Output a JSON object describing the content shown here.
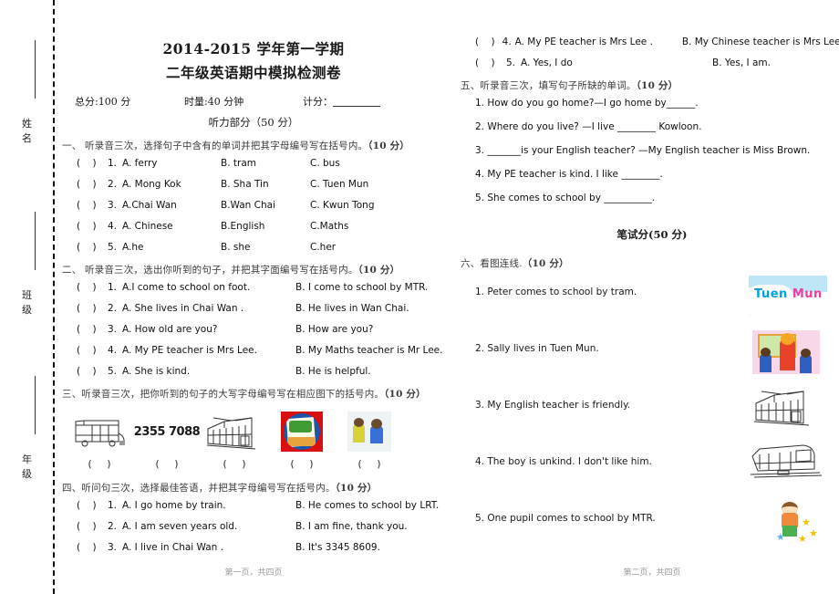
{
  "sidebar": {
    "fields": [
      {
        "label": "姓 名",
        "name": "name-field"
      },
      {
        "label": "班 级",
        "name": "class-field"
      },
      {
        "label": "年 级",
        "name": "grade-field"
      }
    ]
  },
  "header": {
    "title_line1": "2014-2015 学年第一学期",
    "title_line2": "二年级英语期中模拟检测卷",
    "total_score_label": "总分:100 分",
    "time_label": "时量:40 分钟",
    "mark_label": "计分：",
    "listening_part_title": "听力部分（50 分）",
    "written_part_title": "笔试分(50 分)"
  },
  "sections": {
    "s1": {
      "heading": "一、 听录音三次，选择句子中含有的单词并把其字母编号写在括号内。",
      "points": "（10 分）",
      "items": [
        {
          "num": "1.",
          "a": "A. ferry",
          "b": "B. tram",
          "c": "C. bus"
        },
        {
          "num": "2.",
          "a": "A. Mong Kok",
          "b": "B. Sha Tin",
          "c": "C. Tuen Mun"
        },
        {
          "num": "3.",
          "a": "A.Chai Wan",
          "b": "B.Wan Chai",
          "c": "C.  Kwun Tong"
        },
        {
          "num": "4.",
          "a": "A. Chinese",
          "b": "B.English",
          "c": "C.Maths"
        },
        {
          "num": "5.",
          "a": "A.he",
          "b": "B. she",
          "c": "C.her"
        }
      ]
    },
    "s2": {
      "heading": "二、 听录音三次，选出你听到的句子，并把其字面编号写在括号内。",
      "points": "（10 分）",
      "items": [
        {
          "num": "1.",
          "a": "A.I come to school on foot.",
          "b": "B. I come to school by MTR."
        },
        {
          "num": "2.",
          "a": "A. She lives in Chai Wan  .",
          "b": "B. He lives in Wan Chai."
        },
        {
          "num": "3.",
          "a": "A. How old are you?",
          "b": "B. How are you?"
        },
        {
          "num": "4.",
          "a": "A. My PE teacher is Mrs Lee.",
          "b": "B. My Maths teacher is Mr Lee."
        },
        {
          "num": "5.",
          "a": "A. She is kind.",
          "b": "B. He is helpful."
        }
      ]
    },
    "s3": {
      "heading": "三、听录音三次，把你听到的句子的大写字母编号写在相应图下的括号内。",
      "points": "（10 分）",
      "pictures": [
        {
          "icon": "bus-icon",
          "caption": ""
        },
        {
          "icon": "phone-number-text",
          "caption": "2355 7088"
        },
        {
          "icon": "tram-icon",
          "caption": ""
        },
        {
          "icon": "english-book-icon",
          "caption": ""
        },
        {
          "icon": "children-photo-icon",
          "caption": ""
        }
      ],
      "answer_parens": [
        "(     )",
        "(     )",
        "(     )",
        "(     )",
        "(     )"
      ]
    },
    "s4": {
      "heading": "四、听问句三次，选择最佳答语，并把其字母编号写在括号内。",
      "points": "（10 分）",
      "items": [
        {
          "num": "1.",
          "a": "A. I go home by train.",
          "b": "B. He comes to school by LRT."
        },
        {
          "num": "2.",
          "a": "A. I am seven years old.",
          "b": "B. I am fine, thank you."
        },
        {
          "num": "3.",
          "a": "A. I live in Chai Wan .",
          "b": "B. It's 3345 8609."
        },
        {
          "num": "4.",
          "a": "A. My PE teacher is Mrs Lee .",
          "b": "B. My Chinese teacher is Mrs Lee."
        },
        {
          "num": "5.",
          "a": "A. Yes, I do",
          "b": "B. Yes, I am."
        }
      ]
    },
    "s5": {
      "heading": "五、听录音三次，填写句子所缺的单词。",
      "points": "（10 分）",
      "items": [
        "1. How do you go home?—I go home by______.",
        "2. Where do you live? —I live ________ Kowloon.",
        "3. _______is your English teacher? —My English teacher is Miss Brown.",
        "4. My PE teacher is kind. I like ________.",
        "5. She comes to school by __________."
      ]
    },
    "s6": {
      "heading": "六、看图连线.",
      "points": "（10 分）",
      "items": [
        "1. Peter comes to school by tram.",
        "2. Sally lives in Tuen Mun.",
        "3. My English teacher is friendly.",
        "4. The boy is unkind. I don't like him.",
        "5.  One pupil comes to school by MTR."
      ],
      "pictures": [
        {
          "icon": "tuen-mun-map-icon",
          "label_a": "Tuen",
          "label_b": "Mun"
        },
        {
          "icon": "teacher-with-pupils-icon"
        },
        {
          "icon": "tram-icon"
        },
        {
          "icon": "mtr-train-icon"
        },
        {
          "icon": "boy-with-stars-icon"
        }
      ]
    }
  },
  "footers": {
    "left": "第一页，共四页",
    "right": "第二页，共四页"
  },
  "colors": {
    "map_label_teal": "#00a0e9",
    "map_label_pink": "#ea3fa0",
    "book_red": "#d81010",
    "ink": "#333333"
  }
}
